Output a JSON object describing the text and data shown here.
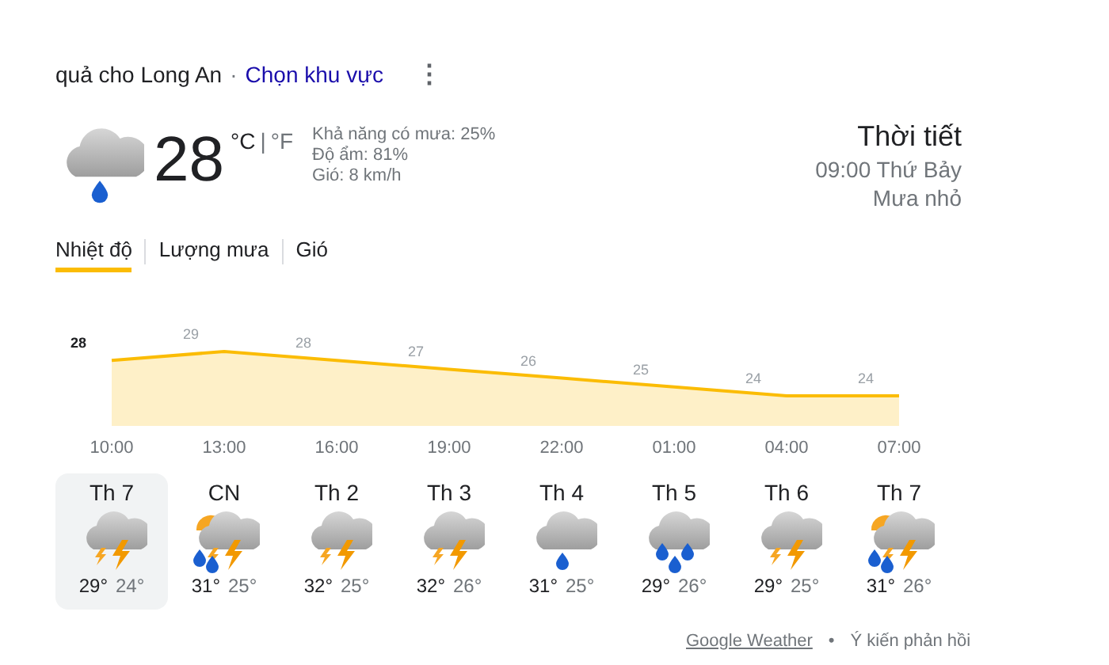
{
  "header": {
    "location": "quả cho Long An",
    "separator": "·",
    "choose_region": "Chọn khu vực",
    "menu": "⋮"
  },
  "current": {
    "kind": "rain-light",
    "temperature": "28",
    "unit_c": "°C",
    "unit_sep": "|",
    "unit_f": "°F",
    "details": [
      "Khả năng có mưa: 25%",
      "Độ ẩm: 81%",
      "Gió: 8 km/h"
    ],
    "title": "Thời tiết",
    "time": "09:00 Thứ Bảy",
    "condition": "Mưa nhỏ"
  },
  "tabs": [
    {
      "label": "Nhiệt độ",
      "selected": true
    },
    {
      "label": "Lượng mưa",
      "selected": false
    },
    {
      "label": "Gió",
      "selected": false
    }
  ],
  "chart_data": {
    "type": "area",
    "categories": [
      "10:00",
      "13:00",
      "16:00",
      "19:00",
      "22:00",
      "01:00",
      "04:00",
      "07:00"
    ],
    "data_labels": true,
    "series": [
      {
        "color": "#fbbc04",
        "values": [
          28,
          29,
          28,
          27,
          26,
          25,
          24,
          24
        ]
      }
    ]
  },
  "days": [
    {
      "day": "Th 7",
      "kind": "thunder",
      "high": "29°",
      "low": "24°",
      "selected": true
    },
    {
      "day": "CN",
      "kind": "sun-thunder-rain",
      "high": "31°",
      "low": "25°",
      "selected": false
    },
    {
      "day": "Th 2",
      "kind": "thunder",
      "high": "32°",
      "low": "25°",
      "selected": false
    },
    {
      "day": "Th 3",
      "kind": "thunder",
      "high": "32°",
      "low": "26°",
      "selected": false
    },
    {
      "day": "Th 4",
      "kind": "rain-light",
      "high": "31°",
      "low": "25°",
      "selected": false
    },
    {
      "day": "Th 5",
      "kind": "rain",
      "high": "29°",
      "low": "26°",
      "selected": false
    },
    {
      "day": "Th 6",
      "kind": "thunder",
      "high": "29°",
      "low": "25°",
      "selected": false
    },
    {
      "day": "Th 7",
      "kind": "sun-thunder-rain",
      "high": "31°",
      "low": "26°",
      "selected": false
    }
  ],
  "footer": {
    "source": "Google Weather",
    "separator": "•",
    "feedback": "Ý kiến phản hồi"
  }
}
